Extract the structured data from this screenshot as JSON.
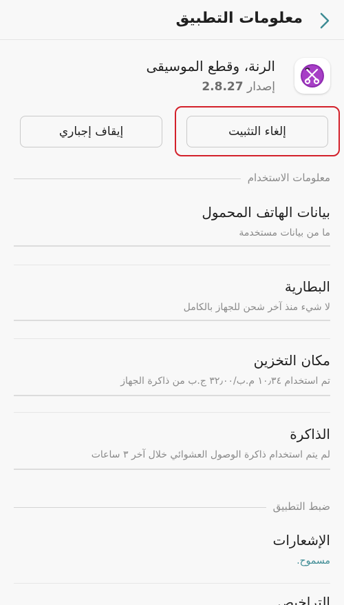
{
  "header": {
    "title": "معلومات التطبيق"
  },
  "app": {
    "name": "الرنة، وقطع الموسيقى",
    "version_label": "إصدار",
    "version_number": "2.8.27",
    "icon": "scissors-music-icon"
  },
  "buttons": {
    "uninstall": "إلغاء التثبيت",
    "force_stop": "إيقاف إجباري"
  },
  "sections": {
    "usage_info": "معلومات الاستخدام",
    "app_settings": "ضبط التطبيق"
  },
  "items": [
    {
      "title": "بيانات الهاتف المحمول",
      "subtitle": "ما من بيانات مستخدمة"
    },
    {
      "title": "البطارية",
      "subtitle": "لا شيء منذ آخر شحن للجهاز بالكامل"
    },
    {
      "title": "مكان التخزين",
      "subtitle": "تم استخدام ١٠٫٣٤ م.ب/٣٢٫٠٠ ج.ب من ذاكرة الجهاز"
    },
    {
      "title": "الذاكرة",
      "subtitle": "لم يتم استخدام ذاكرة الوصول العشوائي خلال آخر ٣ ساعات"
    },
    {
      "title": "الإشعارات",
      "subtitle": "مسموح."
    },
    {
      "title": "التراخيص"
    }
  ],
  "colors": {
    "accent": "#3d8b94",
    "highlight": "#d3202a",
    "icon_purple": "#8e2bb0"
  }
}
